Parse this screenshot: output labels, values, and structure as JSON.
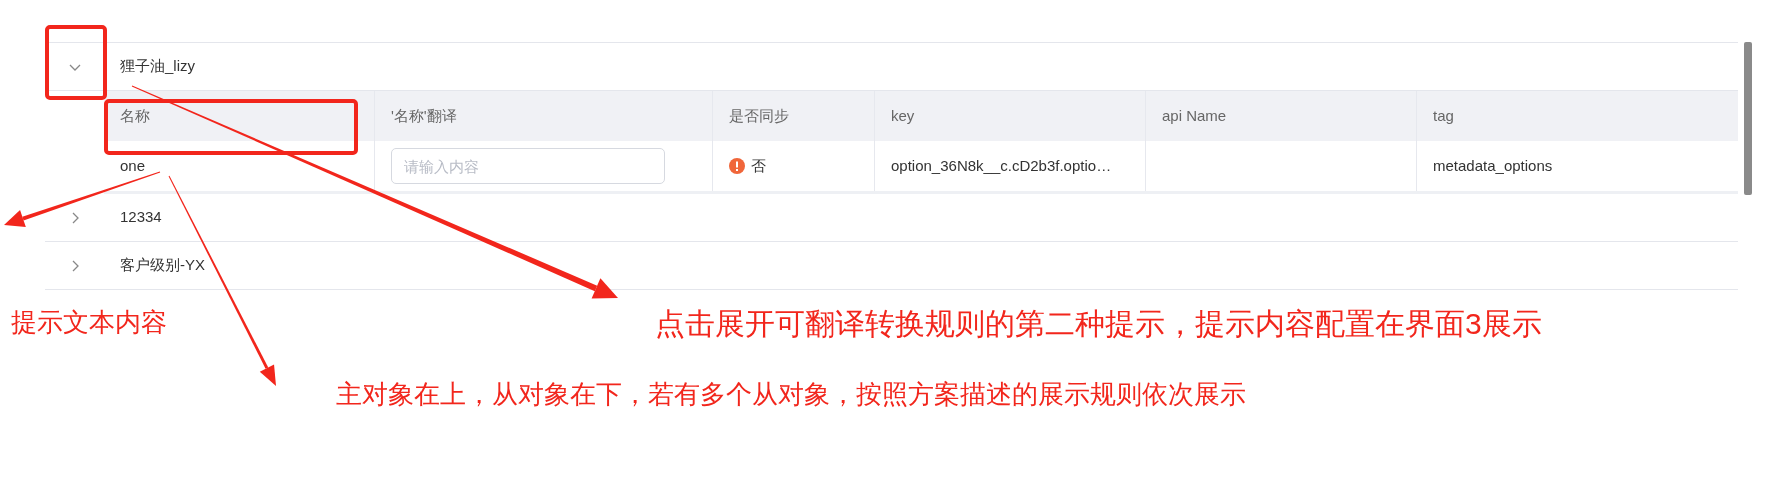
{
  "groups": [
    {
      "name": "狸子油_lizy",
      "expanded": true,
      "table": {
        "columns": [
          "名称",
          "'名称'翻译",
          "是否同步",
          "key",
          "api Name",
          "tag"
        ],
        "rows": [
          {
            "name": "one",
            "translation": {
              "placeholder": "请输入内容"
            },
            "sync": "否",
            "synced": false,
            "key": "option_36N8k__c.cD2b3f.optio…",
            "tag": "metadata_options"
          }
        ]
      }
    },
    {
      "name": "12334",
      "expanded": false
    },
    {
      "name": "客户级别-YX",
      "expanded": false
    }
  ],
  "annotations": [
    {
      "kind": "note",
      "text": "提示文本内容"
    },
    {
      "kind": "note",
      "text": "点击展开可翻译转换规则的第二种提示，提示内容配置在界面3展示"
    },
    {
      "kind": "note",
      "text": "主对象在上，从对象在下，若有多个从对象，按照方案描述的展示规则依次展示"
    }
  ]
}
